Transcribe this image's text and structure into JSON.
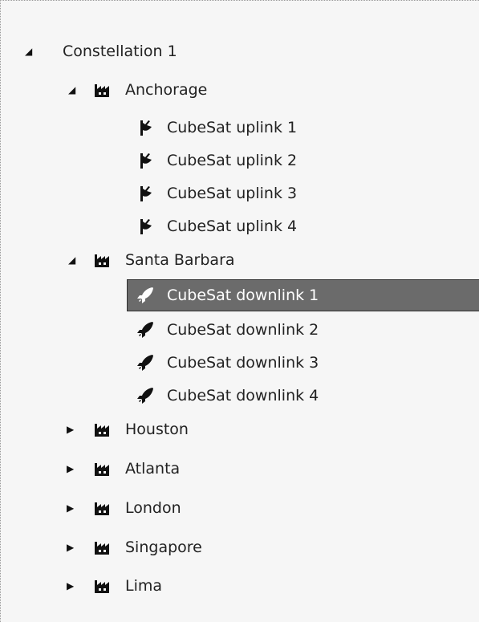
{
  "tree": {
    "root": {
      "label": "Constellation 1",
      "expanded": true
    },
    "sites": [
      {
        "label": "Anchorage",
        "expanded": true,
        "icon": "factory-icon",
        "children": [
          {
            "label": "CubeSat uplink 1",
            "icon": "satellite-dish-icon"
          },
          {
            "label": "CubeSat uplink 2",
            "icon": "satellite-dish-icon"
          },
          {
            "label": "CubeSat uplink 3",
            "icon": "satellite-dish-icon"
          },
          {
            "label": "CubeSat uplink 4",
            "icon": "satellite-dish-icon"
          }
        ]
      },
      {
        "label": "Santa Barbara",
        "expanded": true,
        "icon": "factory-icon",
        "children": [
          {
            "label": "CubeSat downlink 1",
            "icon": "rocket-icon",
            "selected": true
          },
          {
            "label": "CubeSat downlink 2",
            "icon": "rocket-icon"
          },
          {
            "label": "CubeSat downlink 3",
            "icon": "rocket-icon"
          },
          {
            "label": "CubeSat downlink 4",
            "icon": "rocket-icon"
          }
        ]
      },
      {
        "label": "Houston",
        "expanded": false,
        "icon": "factory-icon"
      },
      {
        "label": "Atlanta",
        "expanded": false,
        "icon": "factory-icon"
      },
      {
        "label": "London",
        "expanded": false,
        "icon": "factory-icon"
      },
      {
        "label": "Singapore",
        "expanded": false,
        "icon": "factory-icon"
      },
      {
        "label": "Lima",
        "expanded": false,
        "icon": "factory-icon"
      }
    ],
    "colors": {
      "panel_background": "#f6f6f6",
      "selection_background": "#6b6b6b",
      "selection_text": "#ffffff"
    }
  }
}
